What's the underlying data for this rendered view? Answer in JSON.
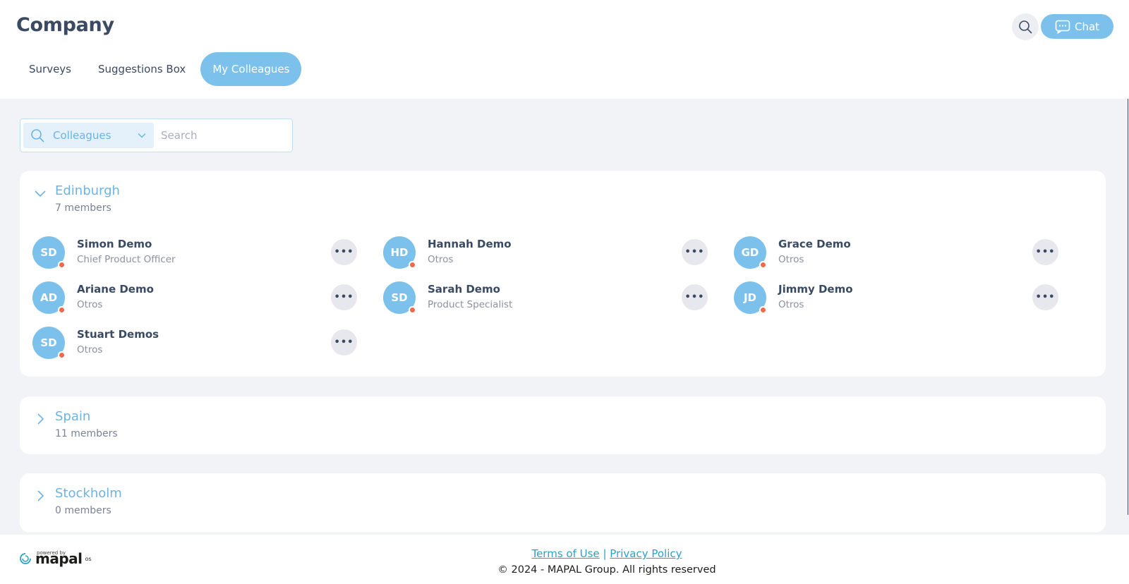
{
  "header": {
    "title": "Company",
    "tabs": [
      {
        "label": "Surveys",
        "active": false
      },
      {
        "label": "Suggestions Box",
        "active": false
      },
      {
        "label": "My Colleagues",
        "active": true
      }
    ],
    "search_icon": "search-icon",
    "chat_label": "Chat",
    "chat_icon": "chat-bubble-icon"
  },
  "search": {
    "scope_label": "Colleagues",
    "placeholder": "Search",
    "value": ""
  },
  "groups": [
    {
      "name": "Edinburgh",
      "count": "7 members",
      "expanded": true,
      "members": [
        {
          "initials": "SD",
          "name": "Simon Demo",
          "role": "Chief Product Officer"
        },
        {
          "initials": "HD",
          "name": "Hannah Demo",
          "role": "Otros"
        },
        {
          "initials": "GD",
          "name": "Grace Demo",
          "role": "Otros"
        },
        {
          "initials": "AD",
          "name": "Ariane Demo",
          "role": "Otros"
        },
        {
          "initials": "SD",
          "name": "Sarah Demo",
          "role": "Product Specialist"
        },
        {
          "initials": "JD",
          "name": "Jimmy Demo",
          "role": "Otros"
        },
        {
          "initials": "SD",
          "name": "Stuart Demos",
          "role": "Otros"
        }
      ]
    },
    {
      "name": "Spain",
      "count": "11 members",
      "expanded": false
    },
    {
      "name": "Stockholm",
      "count": "0 members",
      "expanded": false
    }
  ],
  "footer": {
    "powered_by": "powered by",
    "logo_word": "mapal",
    "logo_suffix": "os",
    "terms_label": "Terms of Use",
    "separator": "|",
    "privacy_label": "Privacy Policy",
    "copyright": "© 2024 - MAPAL Group. All rights reserved"
  },
  "colors": {
    "accent": "#7cc1ec",
    "status_dot": "#ee6a4d",
    "link": "#2aa2c4",
    "background": "#f2f3f6"
  }
}
